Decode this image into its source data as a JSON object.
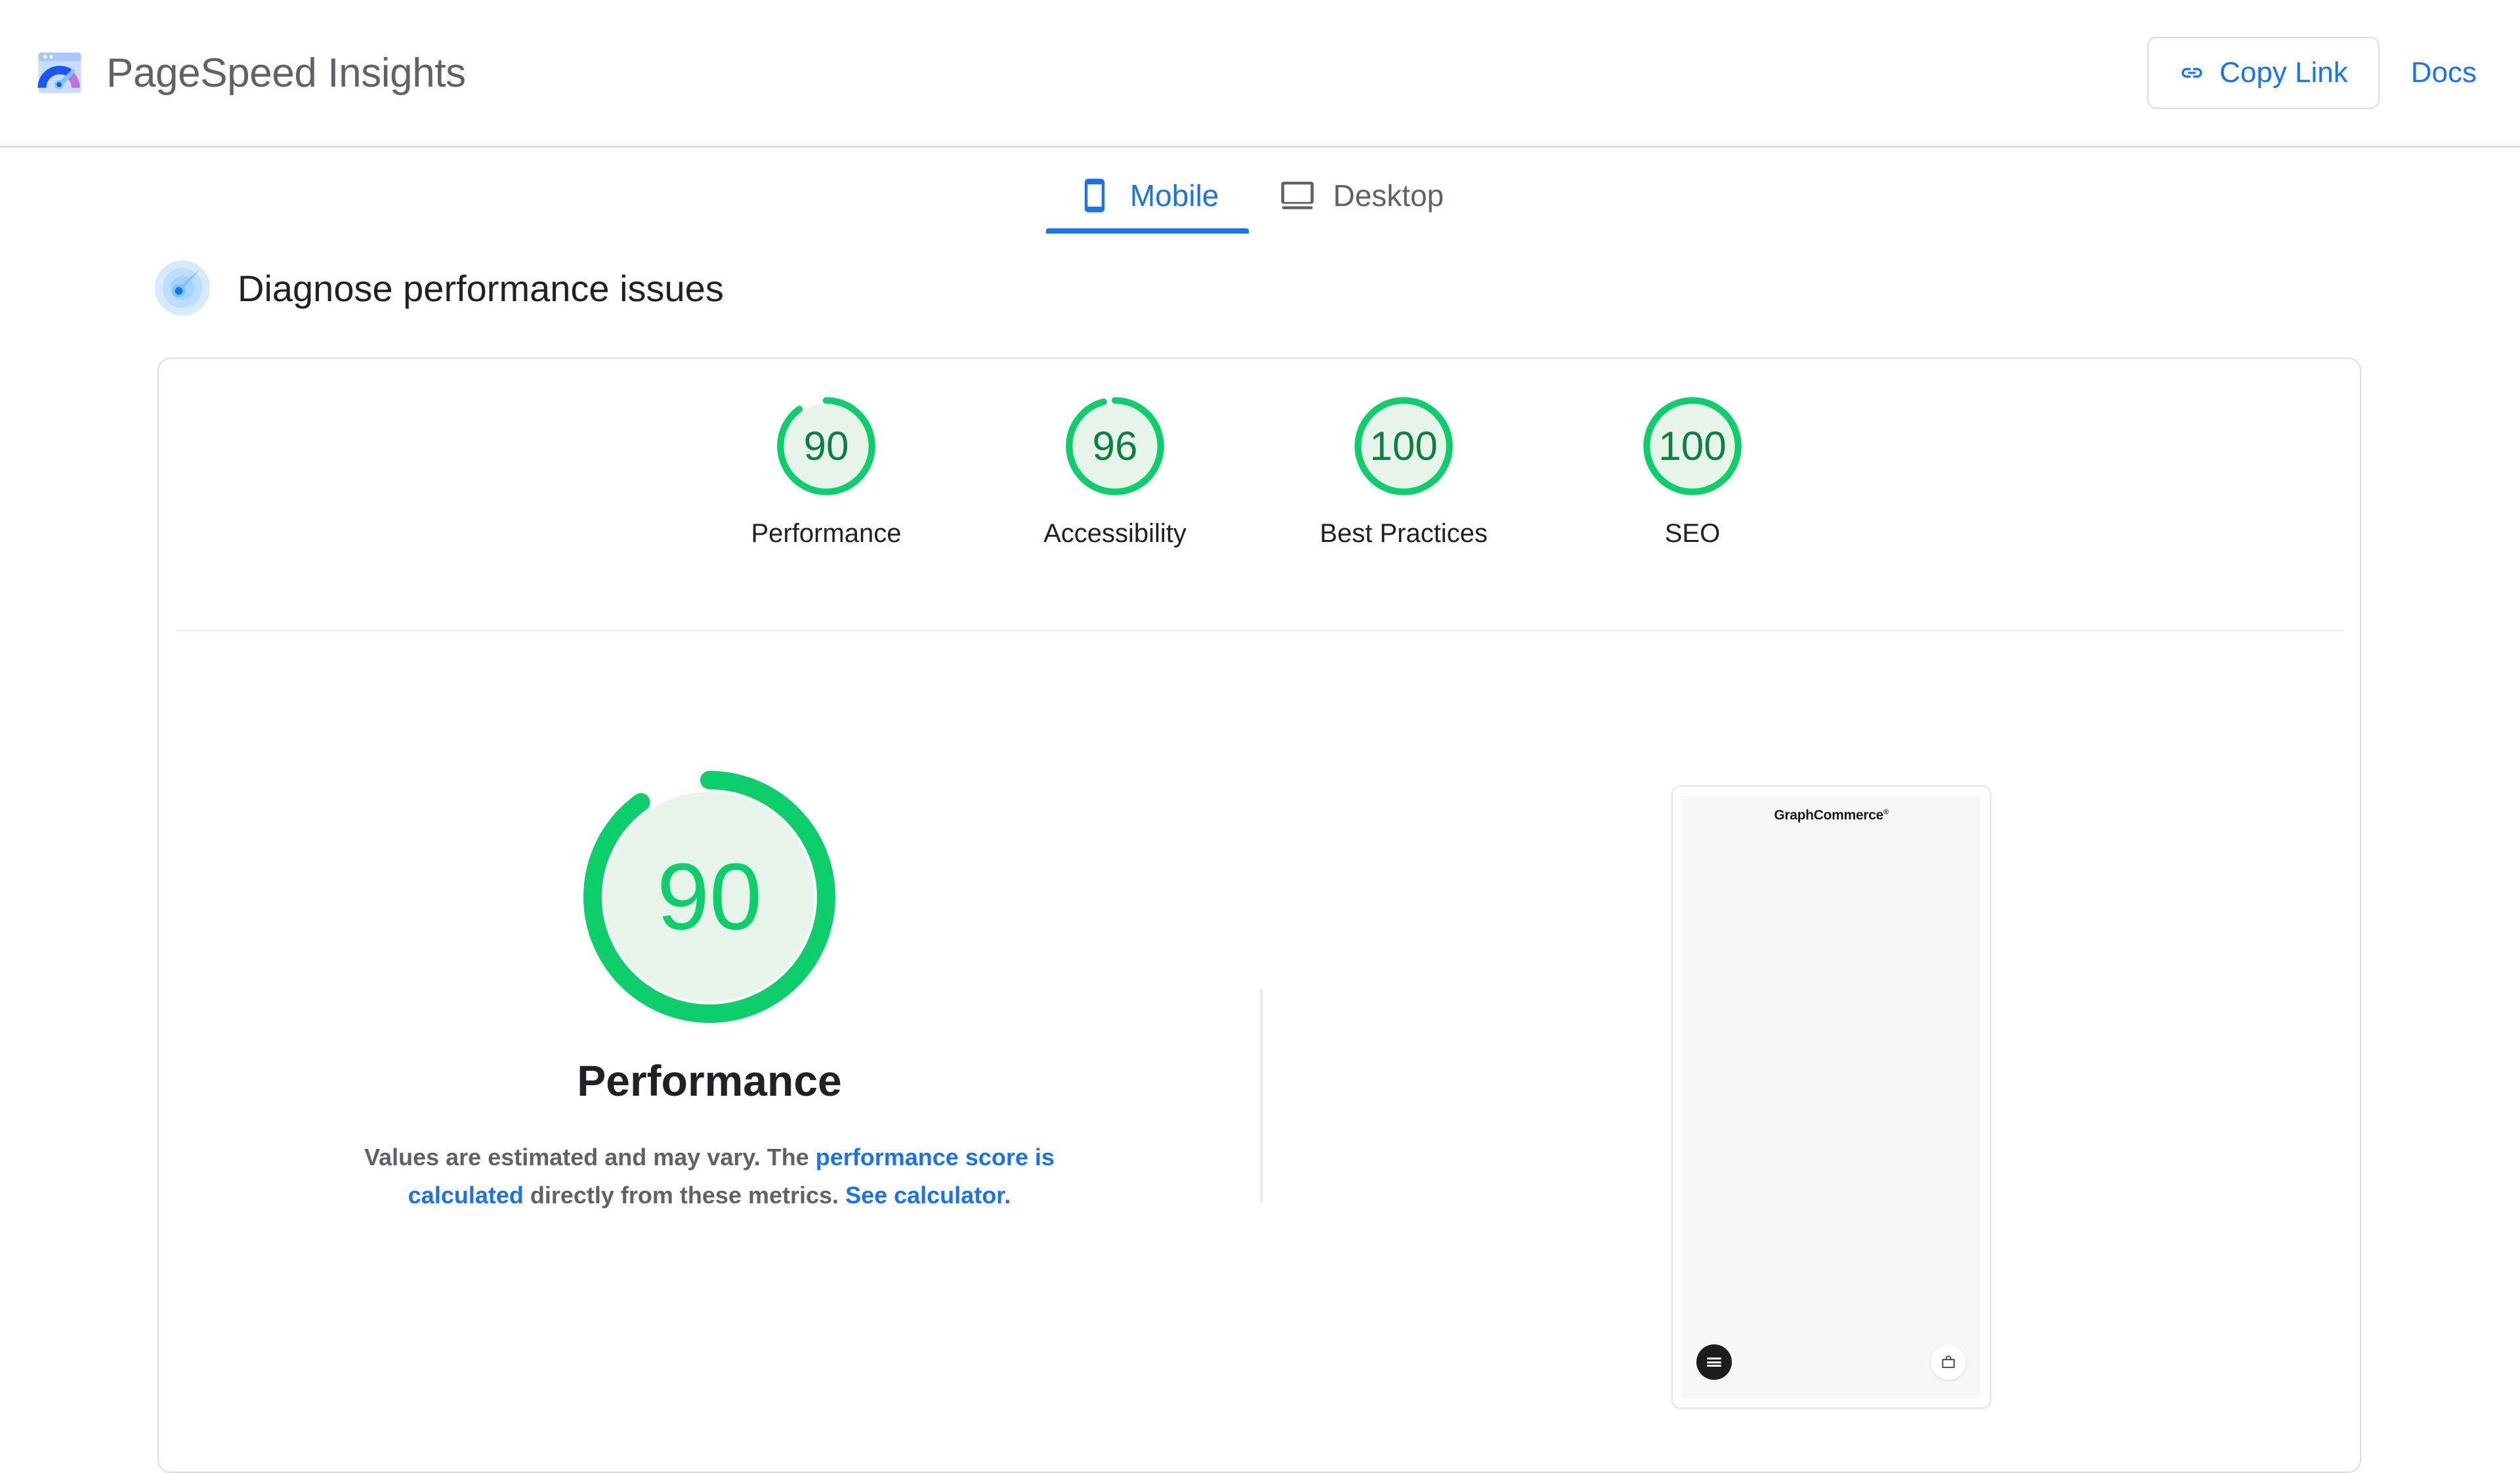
{
  "header": {
    "logo_icon": "pagespeed-logo-icon",
    "title": "PageSpeed Insights",
    "copy_link_label": "Copy Link",
    "copy_link_icon": "link-icon",
    "docs_label": "Docs",
    "accent_color": "#1a73e8",
    "title_color": "#5f6368"
  },
  "tabs": {
    "items": [
      {
        "label": "Mobile",
        "icon": "mobile-icon",
        "active": true
      },
      {
        "label": "Desktop",
        "icon": "desktop-icon",
        "active": false
      }
    ]
  },
  "diagnose": {
    "icon": "speedometer-icon",
    "label": "Diagnose performance issues"
  },
  "scores": {
    "items": [
      {
        "value": "90",
        "percent": 90,
        "label": "Performance"
      },
      {
        "value": "96",
        "percent": 96,
        "label": "Accessibility"
      },
      {
        "value": "100",
        "percent": 100,
        "label": "Best Practices"
      },
      {
        "value": "100",
        "percent": 100,
        "label": "SEO"
      }
    ],
    "good_color": "#0cce6b",
    "good_text_color": "#0c8044",
    "good_fill_color": "#e6f4ea"
  },
  "performance": {
    "gauge_value": "90",
    "gauge_percent": 90,
    "title": "Performance",
    "desc_part1": "Values are estimated and may vary. The ",
    "desc_link1": "performance score is calculated",
    "desc_part2": " directly from these metrics. ",
    "desc_link2": "See calculator."
  },
  "screenshot": {
    "brand": "GraphCommerce",
    "brand_mark": "®",
    "menu_icon": "hamburger-menu-icon",
    "cart_icon": "shopping-bag-icon"
  }
}
